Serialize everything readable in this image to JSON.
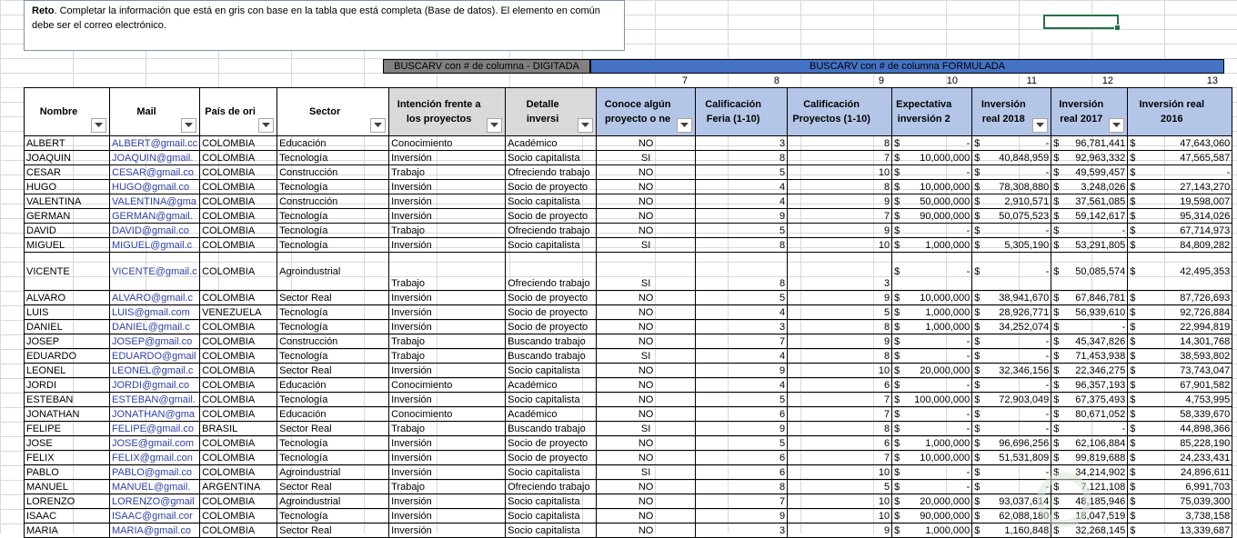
{
  "note": {
    "bold": "Reto",
    "text": ". Completar la información que está en gris con base en la tabla que está completa (Base de datos). El elemento en común debe ser el correo electrónico."
  },
  "group_headers": {
    "digitada": "BUSCARV con # de columna - DIGITADA",
    "formulada": "BUSCARV con # de columna FORMULADA"
  },
  "column_numbers": [
    "7",
    "8",
    "9",
    "10",
    "11",
    "12",
    "13"
  ],
  "columns": [
    "Nombre",
    "Mail",
    "País de ori",
    "Sector",
    "Intención frente a los proyectos",
    "Detalle inversi",
    "Conoce algún proyecto o ne",
    "Calificación Feria (1-10)",
    "Calificación Proyectos (1-10)",
    "Expectativa inversión 2",
    "Inversión real 2018",
    "Inversión real 2017",
    "Inversión real 2016"
  ],
  "colors": {
    "gray_header": "#d9d9d9",
    "blue_header": "#b4c6e7",
    "formulada_bar": "#4472c4",
    "digitada_bar": "#808080",
    "mail_text": "#2f3fa7",
    "selection": "#217346"
  },
  "rows": [
    [
      "ALBERT",
      "ALBERT@gmail.cc",
      "COLOMBIA",
      "Educación",
      "Conocimiento",
      "Académico",
      "NO",
      "3",
      "8",
      "-",
      "-",
      "96,781,441",
      "47,643,060"
    ],
    [
      "JOAQUIN",
      "JOAQUIN@gmail.",
      "COLOMBIA",
      "Tecnología",
      "Inversión",
      "Socio capitalista",
      "SI",
      "8",
      "7",
      "10,000,000",
      "40,848,959",
      "92,963,332",
      "47,565,587"
    ],
    [
      "CESAR",
      "CESAR@gmail.co",
      "COLOMBIA",
      "Construcción",
      "Trabajo",
      "Ofreciendo trabajo",
      "NO",
      "5",
      "10",
      "-",
      "-",
      "49,599,457",
      "-"
    ],
    [
      "HUGO",
      "HUGO@gmail.co",
      "COLOMBIA",
      "Tecnología",
      "Inversión",
      "Socio de proyecto",
      "NO",
      "4",
      "8",
      "10,000,000",
      "78,308,880",
      "3,248,026",
      "27,143,270"
    ],
    [
      "VALENTINA",
      "VALENTINA@gma",
      "COLOMBIA",
      "Construcción",
      "Inversión",
      "Socio capitalista",
      "NO",
      "4",
      "9",
      "50,000,000",
      "2,910,571",
      "37,561,085",
      "19,598,007"
    ],
    [
      "GERMAN",
      "GERMAN@gmail.",
      "COLOMBIA",
      "Tecnología",
      "Inversión",
      "Socio de proyecto",
      "NO",
      "9",
      "7",
      "90,000,000",
      "50,075,523",
      "59,142,617",
      "95,314,026"
    ],
    [
      "DAVID",
      "DAVID@gmail.co",
      "COLOMBIA",
      "Tecnología",
      "Trabajo",
      "Ofreciendo trabajo",
      "NO",
      "5",
      "9",
      "-",
      "-",
      "-",
      "67,714,973"
    ],
    [
      "MIGUEL",
      "MIGUEL@gmail.c",
      "COLOMBIA",
      "Tecnología",
      "Inversión",
      "Socio capitalista",
      "SI",
      "8",
      "10",
      "1,000,000",
      "5,305,190",
      "53,291,805",
      "84,809,282"
    ],
    [
      "VICENTE",
      "VICENTE@gmail.c",
      "COLOMBIA",
      "Agroindustrial",
      "Trabajo",
      "Ofreciendo trabajo",
      "SI",
      "8",
      "3",
      "-",
      "-",
      "50,085,574",
      "42,495,353"
    ],
    [
      "ALVARO",
      "ALVARO@gmail.c",
      "COLOMBIA",
      "Sector Real",
      "Inversión",
      "Socio de proyecto",
      "NO",
      "5",
      "9",
      "10,000,000",
      "38,941,670",
      "67,846,781",
      "87,726,693"
    ],
    [
      "LUIS",
      "LUIS@gmail.com",
      "VENEZUELA",
      "Tecnología",
      "Inversión",
      "Socio de proyecto",
      "NO",
      "4",
      "5",
      "1,000,000",
      "28,926,771",
      "56,939,610",
      "92,726,884"
    ],
    [
      "DANIEL",
      "DANIEL@gmail.c",
      "COLOMBIA",
      "Tecnología",
      "Inversión",
      "Socio de proyecto",
      "NO",
      "3",
      "8",
      "1,000,000",
      "34,252,074",
      "-",
      "22,994,819"
    ],
    [
      "JOSEP",
      "JOSEP@gmail.co",
      "COLOMBIA",
      "Construcción",
      "Trabajo",
      "Buscando trabajo",
      "NO",
      "7",
      "9",
      "-",
      "-",
      "45,347,826",
      "14,301,768"
    ],
    [
      "EDUARDO",
      "EDUARDO@gmail",
      "COLOMBIA",
      "Tecnología",
      "Trabajo",
      "Buscando trabajo",
      "SI",
      "4",
      "8",
      "-",
      "-",
      "71,453,938",
      "38,593,802"
    ],
    [
      "LEONEL",
      "LEONEL@gmail.c",
      "COLOMBIA",
      "Sector Real",
      "Inversión",
      "Socio capitalista",
      "NO",
      "9",
      "10",
      "20,000,000",
      "32,346,156",
      "22,346,275",
      "73,743,047"
    ],
    [
      "JORDI",
      "JORDI@gmail.co",
      "COLOMBIA",
      "Educación",
      "Conocimiento",
      "Académico",
      "NO",
      "4",
      "6",
      "-",
      "-",
      "96,357,193",
      "67,901,582"
    ],
    [
      "ESTEBAN",
      "ESTEBAN@gmail.",
      "COLOMBIA",
      "Tecnología",
      "Inversión",
      "Socio capitalista",
      "NO",
      "5",
      "7",
      "100,000,000",
      "72,903,049",
      "67,375,493",
      "4,753,995"
    ],
    [
      "JONATHAN",
      "JONATHAN@gma",
      "COLOMBIA",
      "Educación",
      "Conocimiento",
      "Académico",
      "NO",
      "6",
      "7",
      "-",
      "-",
      "80,671,052",
      "58,339,670"
    ],
    [
      "FELIPE",
      "FELIPE@gmail.co",
      "BRASIL",
      "Sector Real",
      "Trabajo",
      "Buscando trabajo",
      "SI",
      "9",
      "8",
      "-",
      "-",
      "-",
      "44,898,366"
    ],
    [
      "JOSE",
      "JOSE@gmail.com",
      "COLOMBIA",
      "Tecnología",
      "Inversión",
      "Socio de proyecto",
      "NO",
      "5",
      "6",
      "1,000,000",
      "96,696,256",
      "62,106,884",
      "85,228,190"
    ],
    [
      "FELIX",
      "FELIX@gmail.con",
      "COLOMBIA",
      "Tecnología",
      "Inversión",
      "Socio de proyecto",
      "NO",
      "6",
      "7",
      "10,000,000",
      "51,531,809",
      "99,819,688",
      "24,233,431"
    ],
    [
      "PABLO",
      "PABLO@gmail.co",
      "COLOMBIA",
      "Agroindustrial",
      "Inversión",
      "Socio capitalista",
      "SI",
      "6",
      "10",
      "-",
      "-",
      "34,214,902",
      "24,896,611"
    ],
    [
      "MANUEL",
      "MANUEL@gmail.",
      "ARGENTINA",
      "Sector Real",
      "Trabajo",
      "Ofreciendo trabajo",
      "NO",
      "8",
      "5",
      "-",
      "-",
      "7,121,108",
      "6,991,703"
    ],
    [
      "LORENZO",
      "LORENZO@gmail",
      "COLOMBIA",
      "Agroindustrial",
      "Inversión",
      "Socio capitalista",
      "NO",
      "7",
      "10",
      "20,000,000",
      "93,037,614",
      "48,185,946",
      "75,039,300"
    ],
    [
      "ISAAC",
      "ISAAC@gmail.cor",
      "COLOMBIA",
      "Tecnología",
      "Inversión",
      "Socio capitalista",
      "NO",
      "9",
      "10",
      "90,000,000",
      "62,088,180",
      "18,047,519",
      "3,738,158"
    ],
    [
      "MARIA",
      "MARIA@gmail.co",
      "COLOMBIA",
      "Sector Real",
      "Inversión",
      "Socio capitalista",
      "NO",
      "3",
      "9",
      "1,000,000",
      "1,160,848",
      "32,268,145",
      "13,339,687"
    ]
  ]
}
